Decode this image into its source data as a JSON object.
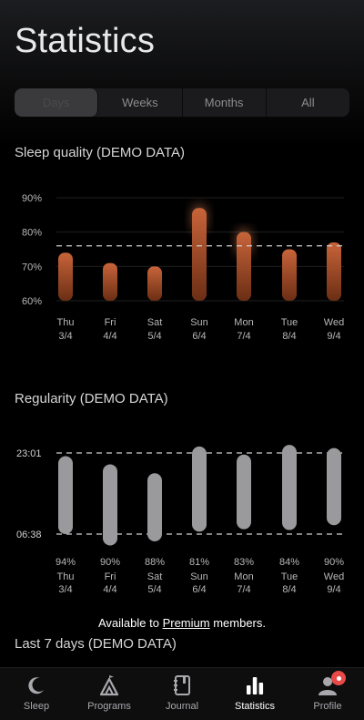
{
  "header": {
    "title": "Statistics"
  },
  "range_tabs": [
    {
      "label": "Days",
      "active": true
    },
    {
      "label": "Weeks",
      "active": false
    },
    {
      "label": "Months",
      "active": false
    },
    {
      "label": "All",
      "active": false
    }
  ],
  "sleep_quality": {
    "title": "Sleep quality (DEMO DATA)"
  },
  "regularity": {
    "title": "Regularity (DEMO DATA)"
  },
  "last7": {
    "title": "Last 7 days (DEMO DATA)"
  },
  "premium": {
    "prefix": "Available to ",
    "link": "Premium",
    "suffix": " members."
  },
  "tabbar": [
    {
      "label": "Sleep",
      "icon": "moon-icon",
      "active": false
    },
    {
      "label": "Programs",
      "icon": "programs-icon",
      "active": false
    },
    {
      "label": "Journal",
      "icon": "journal-icon",
      "active": false
    },
    {
      "label": "Statistics",
      "icon": "bar-chart-icon",
      "active": true
    },
    {
      "label": "Profile",
      "icon": "profile-icon",
      "active": false
    }
  ],
  "colors": {
    "accent_top": "#c8643a",
    "accent_bottom": "#6b2e14",
    "regularity_bar": "#9a9a9c"
  },
  "chart_data": [
    {
      "type": "bar",
      "title": "Sleep quality (DEMO DATA)",
      "categories": [
        "Thu",
        "Fri",
        "Sat",
        "Sun",
        "Mon",
        "Tue",
        "Wed"
      ],
      "dates": [
        "3/4",
        "4/4",
        "5/4",
        "6/4",
        "7/4",
        "8/4",
        "9/4"
      ],
      "values": [
        74,
        71,
        70,
        87,
        80,
        75,
        77
      ],
      "yticks": [
        "90%",
        "80%",
        "70%",
        "60%"
      ],
      "ylim": [
        60,
        90
      ],
      "average": 76,
      "grid": true
    },
    {
      "type": "bar",
      "title": "Regularity (DEMO DATA)",
      "categories": [
        "Thu",
        "Fri",
        "Sat",
        "Sun",
        "Mon",
        "Tue",
        "Wed"
      ],
      "dates": [
        "3/4",
        "4/4",
        "5/4",
        "6/4",
        "7/4",
        "8/4",
        "9/4"
      ],
      "percentages": [
        "94%",
        "90%",
        "88%",
        "81%",
        "83%",
        "84%",
        "90%"
      ],
      "ranges": [
        [
          0.96,
          0.0
        ],
        [
          0.86,
          -0.14
        ],
        [
          0.75,
          -0.09
        ],
        [
          1.08,
          0.03
        ],
        [
          0.98,
          0.06
        ],
        [
          1.1,
          0.05
        ],
        [
          1.06,
          0.11
        ]
      ],
      "ytick_labels": [
        "23:01",
        "06:38"
      ]
    }
  ]
}
